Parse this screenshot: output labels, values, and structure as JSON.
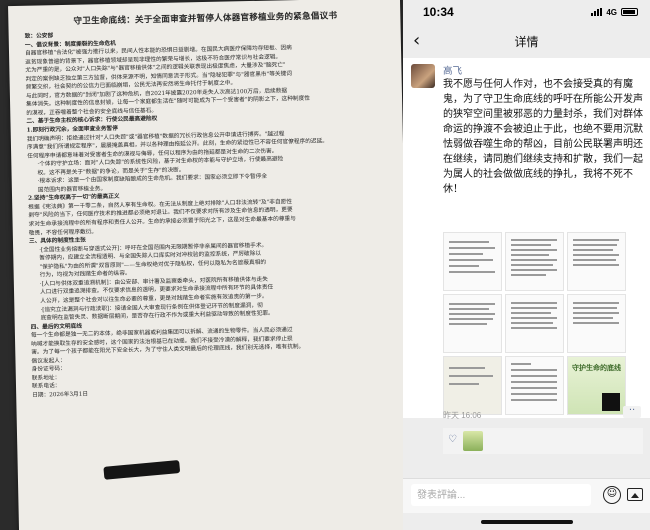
{
  "document": {
    "title": "守卫生命底线：关于全面审查并暂停人体器官移植业务的紧急倡议书",
    "lines": [
      {
        "t": "致：公安部",
        "h": true
      },
      {
        "t": "一、倡议背景：制度撕裂的生命危机",
        "h": true
      },
      {
        "t": "自器官移植\"合法化\"被强力推行以来，民间人性本能的恐惧日益剧增。在国民大病医疗保障均存短板、因病"
      },
      {
        "t": "返贫现象普遍的背景下，器官移植领域却呈现非理性的繁荣与增长，这极不符合医疗常识与社会逻辑。"
      },
      {
        "t": "尤为严重的是，公众对\"人口失踪\"与\"器官移植供体\"之间的逻辑关联表现出极度焦虑，大量涉及\"脑死亡\""
      },
      {
        "t": "判定的案例缺乏独立第三方监督，供体来源不明，知情同意流于形式。当\"隐秘犯罪\"与\"器官黑市\"等关键词"
      },
      {
        "t": "频繁交织，社会契约的公信力已面临崩塌，公民无法再安然将生命托付于制度之中。"
      },
      {
        "t": "与此同时，官方数据的\"封闭\"加剧了这种危机，自2021年披露2020年走失人次高达100万后，后续数据"
      },
      {
        "t": "集体消失。这种制度性的信息封锁，让每一个家庭都生活在\"随时可能成为下一个受害者\"的阴影之下，这种制度性"
      },
      {
        "t": "的漠视，正吞噬着整个社会的安全底线与信任基石。"
      },
      {
        "t": "二、基于生命主权的核心诉求：行使公民最高避险权",
        "h": true
      },
      {
        "t": "1.即刻行政冗余，全面审查业务暂停",
        "h": true
      },
      {
        "t": "我们明确声明：拒绝通过针对\"人口失踪\"或\"器官移植\"数据的冗长行政信息公开申请进行搏弈。\"越过程"
      },
      {
        "t": "序满意\"我们所谓规定程序\"，屡屡掩盖真相，并以各种理由拖延公开。此刻，生命的紧迫性已不容任何官僚程序的迟延。"
      },
      {
        "t": "任何程序申请都意味着对受害者生命的漠视与侮辱，任何以程序为由的拖延都是对生命的二次伤害。"
      },
      {
        "t": "·个体的守护立场：面对\"人口失踪\"的系统性风险，基于对生命权的本能与守护立场，行使最高避险",
        "ind": true
      },
      {
        "t": "权。这不再是关于\"数据\"的争论，而是关于\"生存\"的决断。",
        "ind": true
      },
      {
        "t": "·根本诉求：这是一个由国家制度缺陷酿成的生命危机。我们要求：国家必须立即下令暂停全",
        "ind": true
      },
      {
        "t": "国范围内的器官移植业务。",
        "ind": true
      },
      {
        "t": "2.坚持\"生命权高于一切\"的最高正义",
        "h": true
      },
      {
        "t": "根据《宪法典》第一千零二条，自然人享有生命权。在无法从制度上绝对排除\"人口非法流转\"及\"非自愿性"
      },
      {
        "t": "剥夺\"风险的当下，任何医疗技术的推进都必须绝对退让。我们不仅要求对所有涉及生命信息的透明，更要"
      },
      {
        "t": "求对生命承接流程中的所有程序和责任人公开。生命的承接必须置于阳光之下，这是对生命最基本的尊重与"
      },
      {
        "t": "敬畏，不容任何程序敷衍。"
      },
      {
        "t": "三、具体的制度性主张",
        "h": true
      },
      {
        "t": "·[全国性业务熔断与穿透式公开]：呼吁在全国范围内无限期暂停非亲属间的器官移植手术。",
        "ind": true
      },
      {
        "t": "暂停期内，应建立全流程透明、与全国失踪人口库实时对冲校验的监控系统，严厉破除以",
        "ind": true
      },
      {
        "t": "\"保护隐私\"为由的所谓\"双盲原则\"——生命权绝对优于隐私权，任何以隐私为名遮蔽真相的",
        "ind": true
      },
      {
        "t": "行为，均视为对践踏生命者的纵容。",
        "ind": true
      },
      {
        "t": "·[人口与供体双重追溯机制]：由公安部、审计署及监察委牵头，对医院所有移植供体与走失",
        "ind": true
      },
      {
        "t": "人口进行双重追溯排查。不仅要求信息的透明，更要求对生命承接流程中所有环节的具体责任",
        "ind": true
      },
      {
        "t": "人公开，这是整个社会对以往生命必要的尊重，更是对践踏生命者实施有效追责的第一步。",
        "ind": true
      },
      {
        "t": "·[追究立法漏洞与行政渎职]：接请全国人大审查现行条例在供体登记环节的制度漏洞，彻",
        "ind": true
      },
      {
        "t": "底查明在监管失灵、数据断层期间，是否存在行政不作为或重大利益驱动导致的制度性犯罪。",
        "ind": true
      },
      {
        "t": "四、最后的文明底线",
        "h": true
      },
      {
        "t": "每一个生命都是独一无二的本体，绝非国家机器或利益集团可以拆解、流通的生物零件。当人民必须通过"
      },
      {
        "t": "呐喊才能换取生存的安全感时，这个国家的法治根基已在动摇。我们不接受冷漠的解释，我们要求停止损"
      },
      {
        "t": "害。为了每一个孩子都能在阳光下安全长大，为了守住人类文明最后的伦理底线，我们别无选择，唯有抗制。"
      },
      {
        "t": "倡议发起人："
      },
      {
        "t": "身份证号码："
      },
      {
        "t": "联系地址："
      },
      {
        "t": "联系电话："
      },
      {
        "t": "日期：2026年3月1日"
      }
    ]
  },
  "phone": {
    "status_time": "10:34",
    "network": "4G",
    "nav_title": "详情",
    "post": {
      "username": "高飞",
      "text_lines": [
        "我不愿与任何人作对，也不会接受真的有魔",
        "鬼，为了守卫生命底线的呼吁在所能公开发声",
        "的狭窄空间里被邪恶的力量封杀，我们对群体",
        "命运的挣渡不会被迫止于此，也绝不要用沉默",
        "怯弱做吞噬生命的帮凶，目前公民联署声明还",
        "在继续，请同胞们继续支持和扩散，我们一起",
        "为属人的社会做做底线的挣扎，我将不死不",
        "休！"
      ],
      "poster_title": "守护生命的底线",
      "timestamp": "昨天 16:06"
    },
    "comment_placeholder": "發表評論..."
  }
}
